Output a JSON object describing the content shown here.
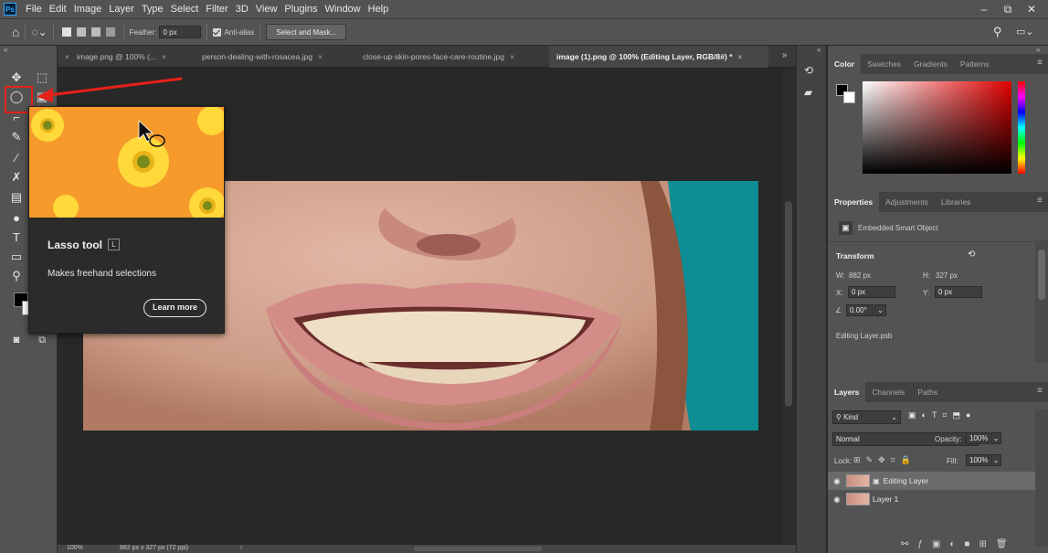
{
  "app": {
    "logo_text": "Ps",
    "menu": [
      "File",
      "Edit",
      "Image",
      "Layer",
      "Type",
      "Select",
      "Filter",
      "3D",
      "View",
      "Plugins",
      "Window",
      "Help"
    ],
    "window_controls": {
      "minimize": "–",
      "restore": "⧉",
      "close": "✕"
    }
  },
  "options_bar": {
    "feather_label": "Feather:",
    "feather_value": "0 px",
    "antialias_label": "Anti-alias",
    "select_mask_label": "Select and Mask..."
  },
  "tabs": [
    {
      "label": "image.png @ 100% (..."
    },
    {
      "label": "person-dealing-with-rosacea.jpg"
    },
    {
      "label": "close-up-skin-pores-face-care-routine.jpg"
    },
    {
      "label": "image (1).png @ 100% (Editing Layer, RGB/8#) *",
      "active": true
    }
  ],
  "tooltip": {
    "title": "Lasso tool",
    "shortcut": "L",
    "description": "Makes freehand selections",
    "learn_more": "Learn more"
  },
  "color_panel": {
    "tabs": [
      "Color",
      "Swatches",
      "Gradients",
      "Patterns"
    ],
    "hue_color": "#e10000"
  },
  "properties_panel": {
    "tabs": [
      "Properties",
      "Adjustments",
      "Libraries"
    ],
    "object_type": "Embedded Smart Object",
    "transform_label": "Transform",
    "w_label": "W:",
    "w_value": "882 px",
    "h_label": "H:",
    "h_value": "327 px",
    "x_label": "X:",
    "x_value": "0 px",
    "y_label": "Y:",
    "y_value": "0 px",
    "angle_value": "0.00°",
    "linked_file": "Editing Layer.psb"
  },
  "layers_panel": {
    "tabs": [
      "Layers",
      "Channels",
      "Paths"
    ],
    "filter_label": "Kind",
    "blend_mode": "Normal",
    "opacity_label": "Opacity:",
    "opacity_value": "100%",
    "lock_label": "Lock:",
    "fill_label": "Fill:",
    "fill_value": "100%",
    "layers": [
      {
        "name": "Editing Layer",
        "selected": true
      },
      {
        "name": "Layer 1",
        "selected": false
      }
    ]
  },
  "status": {
    "zoom": "100%",
    "doc_info": "882 px x 327 px (72 ppi)"
  },
  "colors": {
    "accent_red": "#e32219",
    "tooltip_bg": "#f59a2b"
  }
}
